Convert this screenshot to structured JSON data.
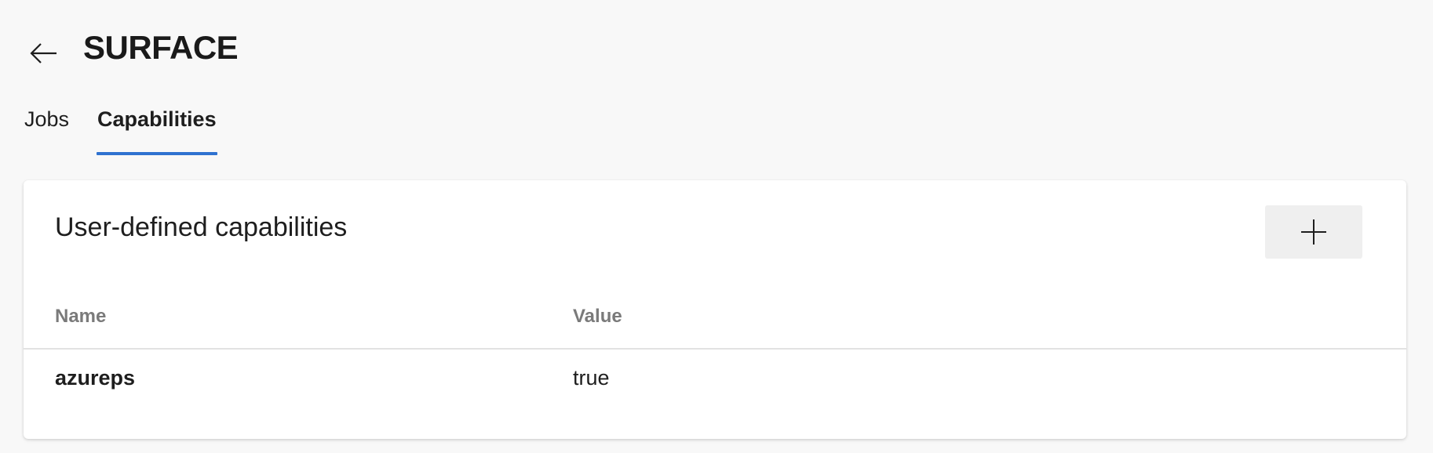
{
  "header": {
    "back_icon": "arrow-left-icon",
    "title": "SURFACE"
  },
  "tabs": [
    {
      "label": "Jobs",
      "selected": false
    },
    {
      "label": "Capabilities",
      "selected": true
    }
  ],
  "colors": {
    "accent": "#2f72d0",
    "page_background": "#f8f8f8",
    "card_background": "#ffffff",
    "column_header_text": "#7a7a7a",
    "add_button_background": "#efefef"
  },
  "capabilities": {
    "title": "User-defined capabilities",
    "add_icon": "plus-icon",
    "columns": [
      "Name",
      "Value"
    ],
    "rows": [
      {
        "name": "azureps",
        "value": "true"
      }
    ]
  }
}
